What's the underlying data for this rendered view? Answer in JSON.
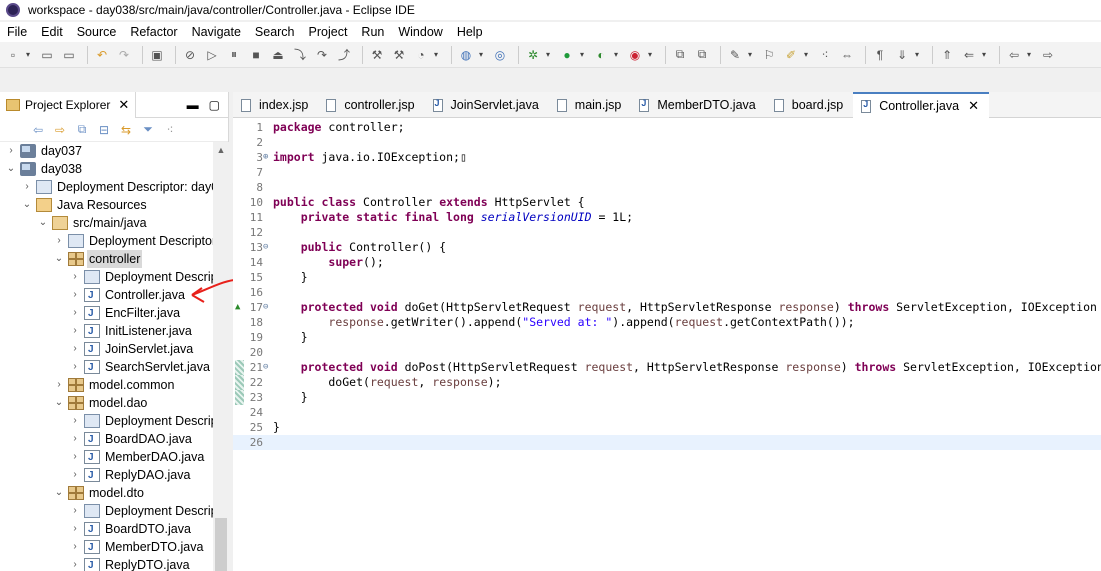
{
  "window": {
    "title": "workspace - day038/src/main/java/controller/Controller.java - Eclipse IDE"
  },
  "menu": [
    "File",
    "Edit",
    "Source",
    "Refactor",
    "Navigate",
    "Search",
    "Project",
    "Run",
    "Window",
    "Help"
  ],
  "toolbar_icons": [
    "new-icon",
    "save-icon",
    "save-all-icon",
    "undo-icon",
    "redo-icon",
    "terminal-icon",
    "skip-breakpoints-icon",
    "resume-icon",
    "suspend-icon",
    "terminate-icon",
    "disconnect-icon",
    "step-into-icon",
    "step-over-icon",
    "step-return-icon",
    "new-java-project-icon",
    "new-package-icon",
    "new-class-icon",
    "open-web-browser-icon",
    "new-java-icon",
    "debug-icon",
    "run-icon",
    "coverage-icon",
    "external-tools-icon",
    "open-type-icon",
    "open-task-icon",
    "search-icon",
    "toggle-breadcrumb-icon",
    "mark-occurrences-icon",
    "block-selection-icon",
    "word-wrap-icon",
    "show-whitespace-icon",
    "next-annotation-icon",
    "previous-annotation-icon",
    "last-edit-icon",
    "back-icon",
    "forward-icon"
  ],
  "explorer": {
    "title": "Project Explorer",
    "tree": [
      {
        "label": "day037",
        "depth": 0,
        "expanded": false,
        "icon": "project"
      },
      {
        "label": "day038",
        "depth": 0,
        "expanded": true,
        "icon": "project"
      },
      {
        "label": "Deployment Descriptor: day0",
        "depth": 1,
        "expanded": false,
        "icon": "dd"
      },
      {
        "label": "Java Resources",
        "depth": 1,
        "expanded": true,
        "icon": "javares"
      },
      {
        "label": "src/main/java",
        "depth": 2,
        "expanded": true,
        "icon": "srcfolder"
      },
      {
        "label": "Deployment Descriptor",
        "depth": 3,
        "expanded": false,
        "icon": "dd"
      },
      {
        "label": "controller",
        "depth": 3,
        "expanded": true,
        "icon": "pkg",
        "selected": true
      },
      {
        "label": "Deployment Descrip",
        "depth": 4,
        "expanded": false,
        "icon": "dd"
      },
      {
        "label": "Controller.java",
        "depth": 4,
        "expanded": false,
        "icon": "java"
      },
      {
        "label": "EncFilter.java",
        "depth": 4,
        "expanded": false,
        "icon": "java"
      },
      {
        "label": "InitListener.java",
        "depth": 4,
        "expanded": false,
        "icon": "java"
      },
      {
        "label": "JoinServlet.java",
        "depth": 4,
        "expanded": false,
        "icon": "java"
      },
      {
        "label": "SearchServlet.java",
        "depth": 4,
        "expanded": false,
        "icon": "java"
      },
      {
        "label": "model.common",
        "depth": 3,
        "expanded": false,
        "icon": "pkg"
      },
      {
        "label": "model.dao",
        "depth": 3,
        "expanded": true,
        "icon": "pkg"
      },
      {
        "label": "Deployment Descrip",
        "depth": 4,
        "expanded": false,
        "icon": "dd"
      },
      {
        "label": "BoardDAO.java",
        "depth": 4,
        "expanded": false,
        "icon": "java"
      },
      {
        "label": "MemberDAO.java",
        "depth": 4,
        "expanded": false,
        "icon": "java"
      },
      {
        "label": "ReplyDAO.java",
        "depth": 4,
        "expanded": false,
        "icon": "java"
      },
      {
        "label": "model.dto",
        "depth": 3,
        "expanded": true,
        "icon": "pkg"
      },
      {
        "label": "Deployment Descrip",
        "depth": 4,
        "expanded": false,
        "icon": "dd"
      },
      {
        "label": "BoardDTO.java",
        "depth": 4,
        "expanded": false,
        "icon": "java"
      },
      {
        "label": "MemberDTO.java",
        "depth": 4,
        "expanded": false,
        "icon": "java"
      },
      {
        "label": "ReplyDTO.java",
        "depth": 4,
        "expanded": false,
        "icon": "java"
      }
    ]
  },
  "editor": {
    "tabs": [
      {
        "label": "index.jsp",
        "type": "jsp"
      },
      {
        "label": "controller.jsp",
        "type": "jsp"
      },
      {
        "label": "JoinServlet.java",
        "type": "java"
      },
      {
        "label": "main.jsp",
        "type": "jsp"
      },
      {
        "label": "MemberDTO.java",
        "type": "java"
      },
      {
        "label": "board.jsp",
        "type": "jsp"
      },
      {
        "label": "Controller.java",
        "type": "java",
        "active": true
      }
    ],
    "lines": [
      {
        "n": "1",
        "html": "<span class=\"kw\">package</span> controller;"
      },
      {
        "n": "2",
        "html": ""
      },
      {
        "n": "3",
        "fold": "⊕",
        "html": "<span class=\"kw\">import</span> java.io.IOException;▯"
      },
      {
        "n": "7",
        "html": ""
      },
      {
        "n": "8",
        "html": ""
      },
      {
        "n": "10",
        "html": "<span class=\"kw\">public class</span> Controller <span class=\"kw\">extends</span> HttpServlet {"
      },
      {
        "n": "11",
        "html": "    <span class=\"kw\">private static final long</span> <span class=\"fld\">serialVersionUID</span> = 1L;"
      },
      {
        "n": "12",
        "html": ""
      },
      {
        "n": "13",
        "fold": "⊖",
        "html": "    <span class=\"kw\">public</span> Controller() {"
      },
      {
        "n": "14",
        "html": "        <span class=\"kw\">super</span>();"
      },
      {
        "n": "15",
        "html": "    }"
      },
      {
        "n": "16",
        "html": ""
      },
      {
        "n": "17",
        "fold": "⊖",
        "mark": "override",
        "html": "    <span class=\"kw\">protected void</span> doGet(HttpServletRequest <span class=\"param\">request</span>, HttpServletResponse <span class=\"param\">response</span>) <span class=\"kw\">throws</span> ServletException, IOException {"
      },
      {
        "n": "18",
        "html": "        <span class=\"param\">response</span>.getWriter().append(<span class=\"str\">\"Served at: \"</span>).append(<span class=\"param\">request</span>.getContextPath());"
      },
      {
        "n": "19",
        "html": "    }"
      },
      {
        "n": "20",
        "html": ""
      },
      {
        "n": "21",
        "fold": "⊖",
        "mark": "change",
        "html": "    <span class=\"kw\">protected void</span> doPost(HttpServletRequest <span class=\"param\">request</span>, HttpServletResponse <span class=\"param\">response</span>) <span class=\"kw\">throws</span> ServletException, IOException {"
      },
      {
        "n": "22",
        "mark": "change",
        "html": "        doGet(<span class=\"param\">request</span>, <span class=\"param\">response</span>);"
      },
      {
        "n": "23",
        "mark": "change",
        "html": "    }"
      },
      {
        "n": "24",
        "html": ""
      },
      {
        "n": "25",
        "html": "}"
      },
      {
        "n": "26",
        "current": true,
        "html": ""
      }
    ]
  }
}
